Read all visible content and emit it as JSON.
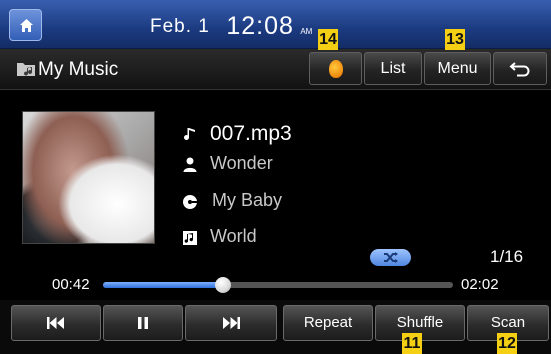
{
  "status_bar": {
    "date": "Feb. 1",
    "time": "12:08",
    "ampm": "AM"
  },
  "title_bar": {
    "title": "My Music",
    "list_label": "List",
    "menu_label": "Menu"
  },
  "track": {
    "file_name": "007.mp3",
    "artist": "Wonder",
    "album": "My Baby",
    "genre": "World",
    "track_count": "1/16"
  },
  "progress": {
    "elapsed": "00:42",
    "total": "02:02",
    "fraction": 0.344
  },
  "controls": {
    "repeat_label": "Repeat",
    "shuffle_label": "Shuffle",
    "scan_label": "Scan"
  },
  "callouts": {
    "shuffle": "11",
    "scan": "12",
    "menu": "13",
    "connection": "14"
  },
  "colors": {
    "status_bar": "#1b3a80",
    "accent_blue": "#2f6fd8",
    "callout_yellow": "#f4cf13"
  },
  "icons": {
    "home": "home-icon",
    "music_folder": "music-folder-icon",
    "connection": "connection-icon",
    "back": "back-arrow-icon",
    "note": "music-note-icon",
    "artist": "person-icon",
    "album": "album-disc-icon",
    "genre": "genre-icon",
    "shuffle": "shuffle-icon",
    "prev": "previous-track-icon",
    "pause": "pause-icon",
    "next": "next-track-icon"
  }
}
